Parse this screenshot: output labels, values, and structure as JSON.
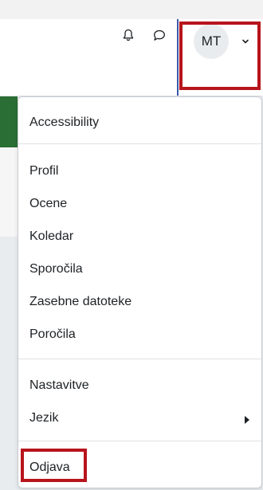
{
  "header": {
    "avatar_initials": "MT",
    "icons": {
      "notifications": "bell-icon",
      "messages": "chat-bubble-icon",
      "user_menu_toggle": "chevron-down-icon"
    }
  },
  "user_menu": {
    "items": [
      {
        "label": "Accessibility"
      },
      {
        "label": "Profil"
      },
      {
        "label": "Ocene"
      },
      {
        "label": "Koledar"
      },
      {
        "label": "Sporočila"
      },
      {
        "label": "Zasebne datoteke"
      },
      {
        "label": "Poročila"
      },
      {
        "label": "Nastavitve"
      },
      {
        "label": "Jezik",
        "submenu_icon": "caret-right-icon"
      },
      {
        "label": "Odjava"
      }
    ]
  },
  "colors": {
    "highlight": "#b8141c",
    "course_header_green": "#2a6e35",
    "navbar_divider": "#3d5aa8",
    "avatar_bg": "#e9ecef",
    "text": "#1d2125"
  }
}
